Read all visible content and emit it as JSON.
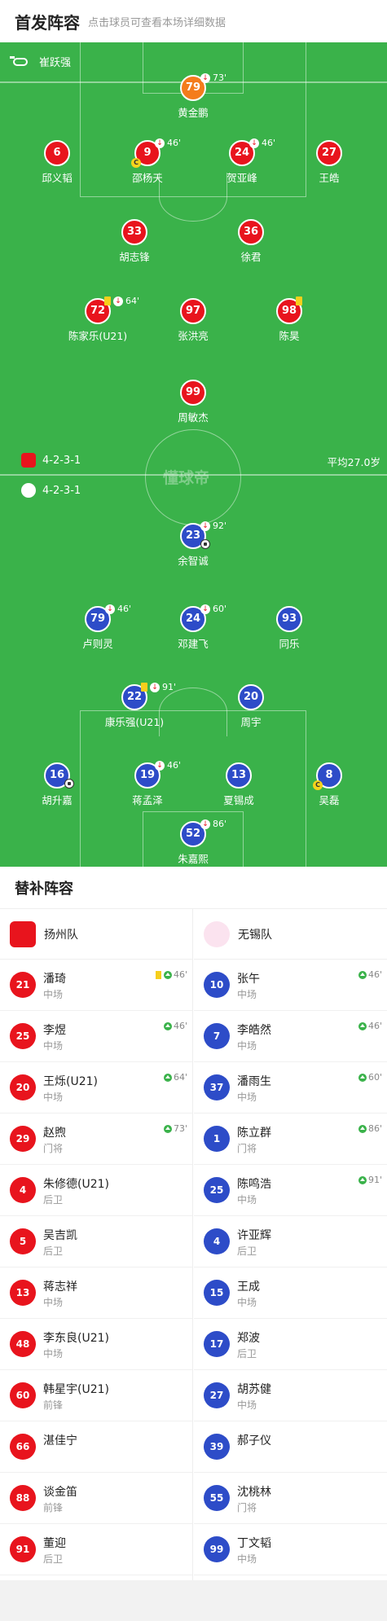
{
  "header": {
    "title": "首发阵容",
    "subtitle": "点击球员可查看本场详细数据"
  },
  "referee": "崔跃强",
  "home": {
    "formation": "4-2-3-1",
    "color": "#e8141d",
    "players": [
      {
        "num": "79",
        "name": "黄金鹏",
        "sub": "73'",
        "color": "orange"
      },
      {
        "num": "6",
        "name": "邱义韬"
      },
      {
        "num": "9",
        "name": "邵杨天",
        "sub": "46'",
        "captain": "C"
      },
      {
        "num": "24",
        "name": "贺亚峰",
        "sub": "46'"
      },
      {
        "num": "27",
        "name": "王皓"
      },
      {
        "num": "33",
        "name": "胡志锋"
      },
      {
        "num": "36",
        "name": "徐君"
      },
      {
        "num": "72",
        "name": "陈家乐(U21)",
        "sub": "64'",
        "yellow": true
      },
      {
        "num": "97",
        "name": "张洪亮"
      },
      {
        "num": "98",
        "name": "陈昊",
        "yellow": true
      },
      {
        "num": "99",
        "name": "周敏杰"
      }
    ]
  },
  "away": {
    "formation": "4-2-3-1",
    "color": "#2d4cc8",
    "players": [
      {
        "num": "23",
        "name": "余智诚",
        "sub": "92'",
        "goal": true
      },
      {
        "num": "79",
        "name": "卢则灵",
        "sub": "46'"
      },
      {
        "num": "24",
        "name": "邓建飞",
        "sub": "60'"
      },
      {
        "num": "93",
        "name": "同乐"
      },
      {
        "num": "22",
        "name": "康乐强(U21)",
        "sub": "91'",
        "yellow": true
      },
      {
        "num": "20",
        "name": "周宇"
      },
      {
        "num": "16",
        "name": "胡升嘉",
        "goal": true
      },
      {
        "num": "19",
        "name": "蒋孟泽",
        "sub": "46'"
      },
      {
        "num": "13",
        "name": "夏锡成"
      },
      {
        "num": "8",
        "name": "吴磊",
        "captain": "C"
      },
      {
        "num": "52",
        "name": "朱嘉熙",
        "sub": "86'"
      }
    ]
  },
  "avg_age": "平均27.0岁",
  "watermark": "懂球帝",
  "subs": {
    "title": "替补阵容",
    "home_team": "扬州队",
    "away_team": "无锡队",
    "home": [
      {
        "num": "21",
        "name": "潘琦",
        "pos": "中场",
        "time": "46'",
        "yellow": true
      },
      {
        "num": "25",
        "name": "李煜",
        "pos": "中场",
        "time": "46'"
      },
      {
        "num": "20",
        "name": "王烁(U21)",
        "pos": "中场",
        "time": "64'"
      },
      {
        "num": "29",
        "name": "赵煦",
        "pos": "门将",
        "time": "73'"
      },
      {
        "num": "4",
        "name": "朱修德(U21)",
        "pos": "后卫"
      },
      {
        "num": "5",
        "name": "吴吉凯",
        "pos": "后卫"
      },
      {
        "num": "13",
        "name": "蒋志祥",
        "pos": "中场"
      },
      {
        "num": "48",
        "name": "李东良(U21)",
        "pos": "中场"
      },
      {
        "num": "60",
        "name": "韩星宇(U21)",
        "pos": "前锋"
      },
      {
        "num": "66",
        "name": "湛佳宁",
        "pos": ""
      },
      {
        "num": "88",
        "name": "谈金笛",
        "pos": "前锋"
      },
      {
        "num": "91",
        "name": "董迎",
        "pos": "后卫"
      }
    ],
    "away": [
      {
        "num": "10",
        "name": "张午",
        "pos": "中场",
        "time": "46'"
      },
      {
        "num": "7",
        "name": "李皓然",
        "pos": "中场",
        "time": "46'"
      },
      {
        "num": "37",
        "name": "潘雨生",
        "pos": "中场",
        "time": "60'"
      },
      {
        "num": "1",
        "name": "陈立群",
        "pos": "门将",
        "time": "86'"
      },
      {
        "num": "25",
        "name": "陈鸣浩",
        "pos": "中场",
        "time": "91'"
      },
      {
        "num": "4",
        "name": "许亚辉",
        "pos": "后卫"
      },
      {
        "num": "15",
        "name": "王成",
        "pos": "中场"
      },
      {
        "num": "17",
        "name": "郑波",
        "pos": "后卫"
      },
      {
        "num": "27",
        "name": "胡苏健",
        "pos": "中场"
      },
      {
        "num": "39",
        "name": "郝子仪",
        "pos": ""
      },
      {
        "num": "55",
        "name": "沈桃林",
        "pos": "门将"
      },
      {
        "num": "99",
        "name": "丁文韬",
        "pos": "中场"
      }
    ]
  }
}
